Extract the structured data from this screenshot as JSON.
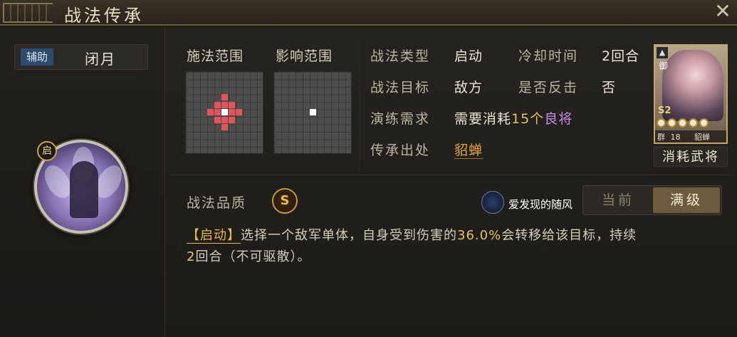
{
  "window": {
    "title": "战法传承",
    "close_symbol": "✕"
  },
  "left": {
    "role_tag": "辅助",
    "skill_name": "闭月",
    "badge": "启"
  },
  "ranges": {
    "cast_label": "施法范围",
    "effect_label": "影响范围"
  },
  "info": {
    "type_label": "战法类型",
    "type_value": "启动",
    "cooldown_label": "冷却时间",
    "cooldown_value": "2回合",
    "target_label": "战法目标",
    "target_value": "敌方",
    "counter_label": "是否反击",
    "counter_value": "否",
    "train_label": "演练需求",
    "train_prefix": "需要消耗",
    "train_count": "15个",
    "train_quality": "良将",
    "source_label": "传承出处",
    "source_value": "貂蝉"
  },
  "card": {
    "corner": "御",
    "side_text": "御",
    "season": "S2",
    "stars": 5,
    "cost_prefix": "群",
    "cost": "18",
    "name": "貂蝉",
    "caption": "消耗武将"
  },
  "quality": {
    "label": "战法品质",
    "grade": "S"
  },
  "watermark": {
    "text": "爱发现的随风"
  },
  "toggle": {
    "current": "当前",
    "max": "满级",
    "selected": "max"
  },
  "description": {
    "tag": "【启动】",
    "part1": "选择一个敌军单体，自身受到伤害的",
    "percent": "36.0%",
    "part2": "会转移给该目标，持续",
    "turns": "2",
    "part3": "回合（不可驱散）。"
  },
  "colors": {
    "accent_gold": "#e8c15a",
    "accent_purple": "#c58ae6",
    "range_red": "#e0545a",
    "role_blue": "#2c4a6e"
  }
}
